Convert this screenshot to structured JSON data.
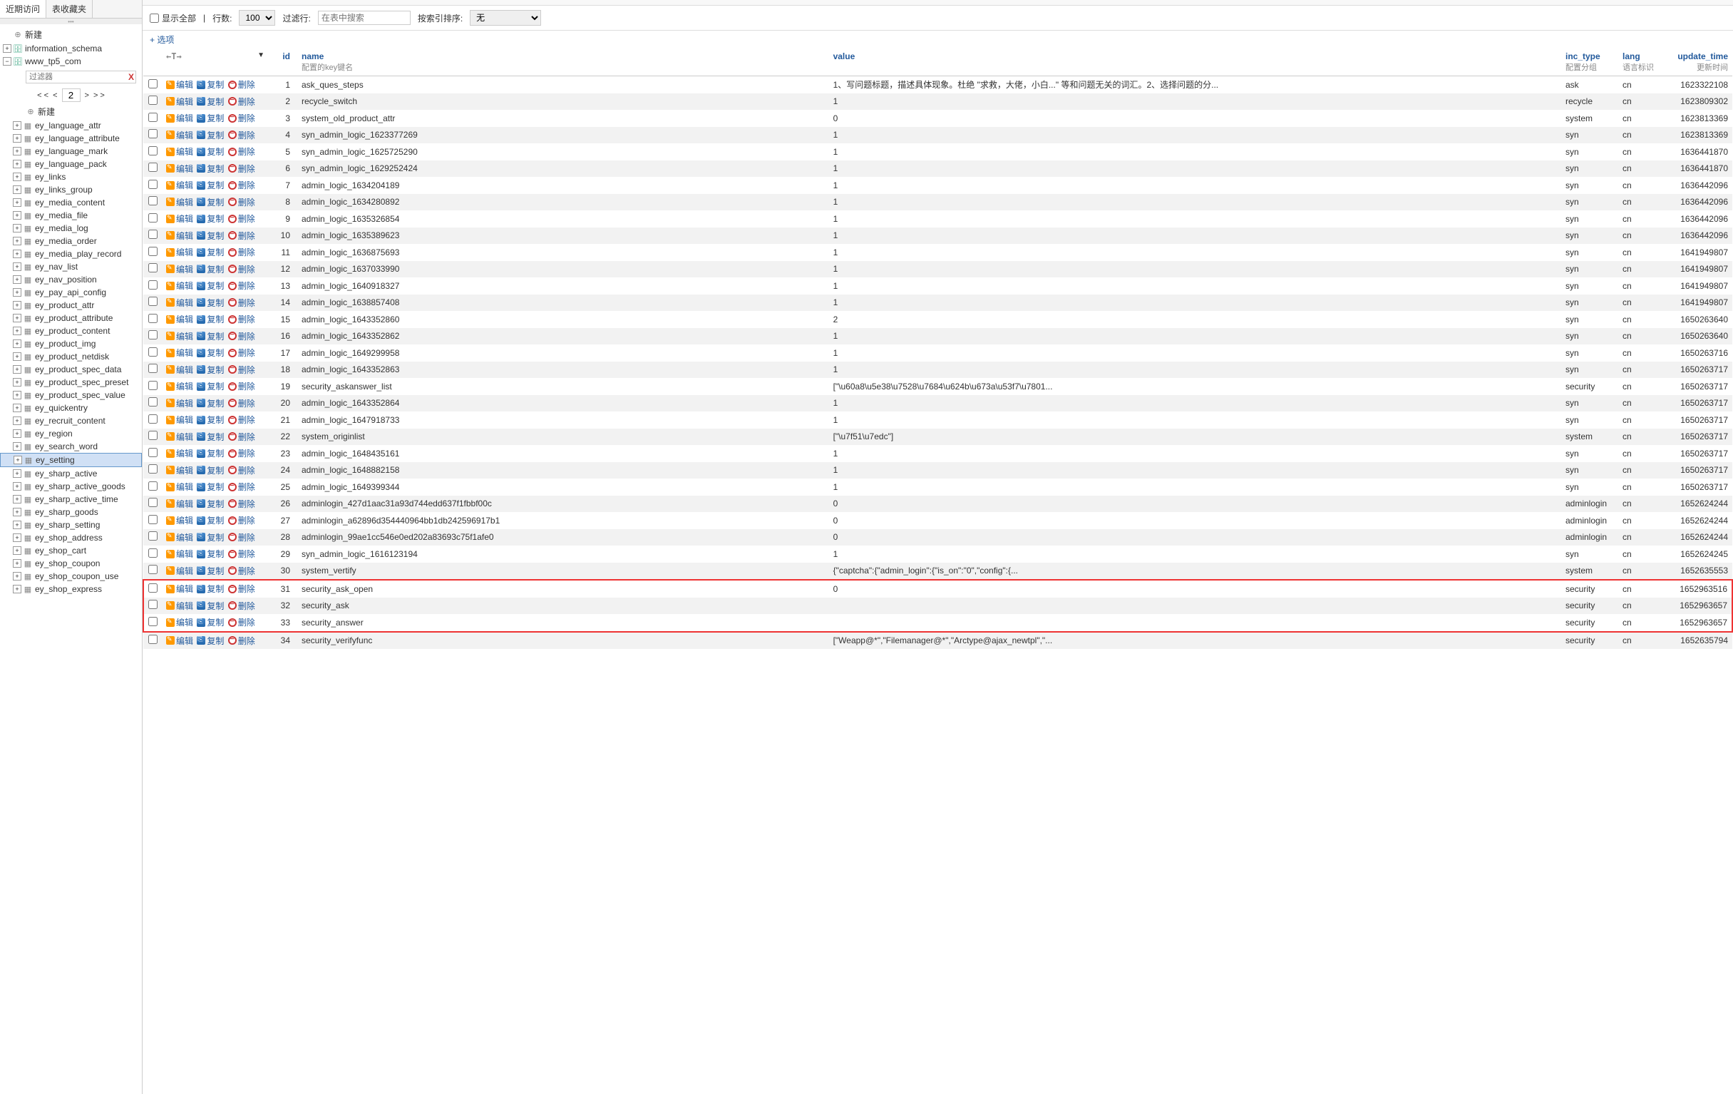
{
  "sidebar": {
    "tabs": {
      "recent": "近期访问",
      "favorites": "表收藏夹"
    },
    "new_label": "新建",
    "db_info": "information_schema",
    "db_current": "www_tp5_com",
    "filter_placeholder": "过滤器",
    "pager": {
      "page": "2",
      "prev2": "< <",
      "prev": "<",
      "next": ">",
      "next2": "> >"
    },
    "inner_new": "新建",
    "tables": [
      "ey_language_attr",
      "ey_language_attribute",
      "ey_language_mark",
      "ey_language_pack",
      "ey_links",
      "ey_links_group",
      "ey_media_content",
      "ey_media_file",
      "ey_media_log",
      "ey_media_order",
      "ey_media_play_record",
      "ey_nav_list",
      "ey_nav_position",
      "ey_pay_api_config",
      "ey_product_attr",
      "ey_product_attribute",
      "ey_product_content",
      "ey_product_img",
      "ey_product_netdisk",
      "ey_product_spec_data",
      "ey_product_spec_preset",
      "ey_product_spec_value",
      "ey_quickentry",
      "ey_recruit_content",
      "ey_region",
      "ey_search_word",
      "ey_setting",
      "ey_sharp_active",
      "ey_sharp_active_goods",
      "ey_sharp_active_time",
      "ey_sharp_goods",
      "ey_sharp_setting",
      "ey_shop_address",
      "ey_shop_cart",
      "ey_shop_coupon",
      "ey_shop_coupon_use",
      "ey_shop_express"
    ],
    "selected_table": "ey_setting"
  },
  "controls": {
    "show_all": "显示全部",
    "rows_label": "行数:",
    "rows_value": "100",
    "filter_label": "过滤行:",
    "filter_placeholder": "在表中搜索",
    "sort_label": "按索引排序:",
    "sort_value": "无"
  },
  "options_link": "+ 选项",
  "columns": {
    "nav": "←T→",
    "id": "id",
    "name": {
      "label": "name",
      "sub": "配置的key键名"
    },
    "value": "value",
    "inc_type": {
      "label": "inc_type",
      "sub": "配置分组"
    },
    "lang": {
      "label": "lang",
      "sub": "语言标识"
    },
    "update_time": {
      "label": "update_time",
      "sub": "更新时间"
    }
  },
  "actions": {
    "edit": "编辑",
    "copy": "复制",
    "delete": "删除"
  },
  "highlight_rows": [
    31,
    32,
    33
  ],
  "rows": [
    {
      "id": 1,
      "name": "ask_ques_steps",
      "value": "1、写问题标题，描述具体现象。杜绝 \"求救，大佬，小白...\" 等和问题无关的词汇。2、选择问题的分...",
      "inc_type": "ask",
      "lang": "cn",
      "update_time": "1623322108"
    },
    {
      "id": 2,
      "name": "recycle_switch",
      "value": "1",
      "inc_type": "recycle",
      "lang": "cn",
      "update_time": "1623809302"
    },
    {
      "id": 3,
      "name": "system_old_product_attr",
      "value": "0",
      "inc_type": "system",
      "lang": "cn",
      "update_time": "1623813369"
    },
    {
      "id": 4,
      "name": "syn_admin_logic_1623377269",
      "value": "1",
      "inc_type": "syn",
      "lang": "cn",
      "update_time": "1623813369"
    },
    {
      "id": 5,
      "name": "syn_admin_logic_1625725290",
      "value": "1",
      "inc_type": "syn",
      "lang": "cn",
      "update_time": "1636441870"
    },
    {
      "id": 6,
      "name": "syn_admin_logic_1629252424",
      "value": "1",
      "inc_type": "syn",
      "lang": "cn",
      "update_time": "1636441870"
    },
    {
      "id": 7,
      "name": "admin_logic_1634204189",
      "value": "1",
      "inc_type": "syn",
      "lang": "cn",
      "update_time": "1636442096"
    },
    {
      "id": 8,
      "name": "admin_logic_1634280892",
      "value": "1",
      "inc_type": "syn",
      "lang": "cn",
      "update_time": "1636442096"
    },
    {
      "id": 9,
      "name": "admin_logic_1635326854",
      "value": "1",
      "inc_type": "syn",
      "lang": "cn",
      "update_time": "1636442096"
    },
    {
      "id": 10,
      "name": "admin_logic_1635389623",
      "value": "1",
      "inc_type": "syn",
      "lang": "cn",
      "update_time": "1636442096"
    },
    {
      "id": 11,
      "name": "admin_logic_1636875693",
      "value": "1",
      "inc_type": "syn",
      "lang": "cn",
      "update_time": "1641949807"
    },
    {
      "id": 12,
      "name": "admin_logic_1637033990",
      "value": "1",
      "inc_type": "syn",
      "lang": "cn",
      "update_time": "1641949807"
    },
    {
      "id": 13,
      "name": "admin_logic_1640918327",
      "value": "1",
      "inc_type": "syn",
      "lang": "cn",
      "update_time": "1641949807"
    },
    {
      "id": 14,
      "name": "admin_logic_1638857408",
      "value": "1",
      "inc_type": "syn",
      "lang": "cn",
      "update_time": "1641949807"
    },
    {
      "id": 15,
      "name": "admin_logic_1643352860",
      "value": "2",
      "inc_type": "syn",
      "lang": "cn",
      "update_time": "1650263640"
    },
    {
      "id": 16,
      "name": "admin_logic_1643352862",
      "value": "1",
      "inc_type": "syn",
      "lang": "cn",
      "update_time": "1650263640"
    },
    {
      "id": 17,
      "name": "admin_logic_1649299958",
      "value": "1",
      "inc_type": "syn",
      "lang": "cn",
      "update_time": "1650263716"
    },
    {
      "id": 18,
      "name": "admin_logic_1643352863",
      "value": "1",
      "inc_type": "syn",
      "lang": "cn",
      "update_time": "1650263717"
    },
    {
      "id": 19,
      "name": "security_askanswer_list",
      "value": "[\"\\u60a8\\u5e38\\u7528\\u7684\\u624b\\u673a\\u53f7\\u7801...",
      "inc_type": "security",
      "lang": "cn",
      "update_time": "1650263717"
    },
    {
      "id": 20,
      "name": "admin_logic_1643352864",
      "value": "1",
      "inc_type": "syn",
      "lang": "cn",
      "update_time": "1650263717"
    },
    {
      "id": 21,
      "name": "admin_logic_1647918733",
      "value": "1",
      "inc_type": "syn",
      "lang": "cn",
      "update_time": "1650263717"
    },
    {
      "id": 22,
      "name": "system_originlist",
      "value": "[\"\\u7f51\\u7edc\"]",
      "inc_type": "system",
      "lang": "cn",
      "update_time": "1650263717"
    },
    {
      "id": 23,
      "name": "admin_logic_1648435161",
      "value": "1",
      "inc_type": "syn",
      "lang": "cn",
      "update_time": "1650263717"
    },
    {
      "id": 24,
      "name": "admin_logic_1648882158",
      "value": "1",
      "inc_type": "syn",
      "lang": "cn",
      "update_time": "1650263717"
    },
    {
      "id": 25,
      "name": "admin_logic_1649399344",
      "value": "1",
      "inc_type": "syn",
      "lang": "cn",
      "update_time": "1650263717"
    },
    {
      "id": 26,
      "name": "adminlogin_427d1aac31a93d744edd637f1fbbf00c",
      "value": "0",
      "inc_type": "adminlogin",
      "lang": "cn",
      "update_time": "1652624244"
    },
    {
      "id": 27,
      "name": "adminlogin_a62896d354440964bb1db242596917b1",
      "value": "0",
      "inc_type": "adminlogin",
      "lang": "cn",
      "update_time": "1652624244"
    },
    {
      "id": 28,
      "name": "adminlogin_99ae1cc546e0ed202a83693c75f1afe0",
      "value": "0",
      "inc_type": "adminlogin",
      "lang": "cn",
      "update_time": "1652624244"
    },
    {
      "id": 29,
      "name": "syn_admin_logic_1616123194",
      "value": "1",
      "inc_type": "syn",
      "lang": "cn",
      "update_time": "1652624245"
    },
    {
      "id": 30,
      "name": "system_vertify",
      "value": "{\"captcha\":{\"admin_login\":{\"is_on\":\"0\",\"config\":{...",
      "inc_type": "system",
      "lang": "cn",
      "update_time": "1652635553"
    },
    {
      "id": 31,
      "name": "security_ask_open",
      "value": "0",
      "inc_type": "security",
      "lang": "cn",
      "update_time": "1652963516"
    },
    {
      "id": 32,
      "name": "security_ask",
      "value": "",
      "inc_type": "security",
      "lang": "cn",
      "update_time": "1652963657"
    },
    {
      "id": 33,
      "name": "security_answer",
      "value": "",
      "inc_type": "security",
      "lang": "cn",
      "update_time": "1652963657"
    },
    {
      "id": 34,
      "name": "security_verifyfunc",
      "value": "[\"Weapp@*\",\"Filemanager@*\",\"Arctype@ajax_newtpl\",\"...",
      "inc_type": "security",
      "lang": "cn",
      "update_time": "1652635794"
    }
  ]
}
